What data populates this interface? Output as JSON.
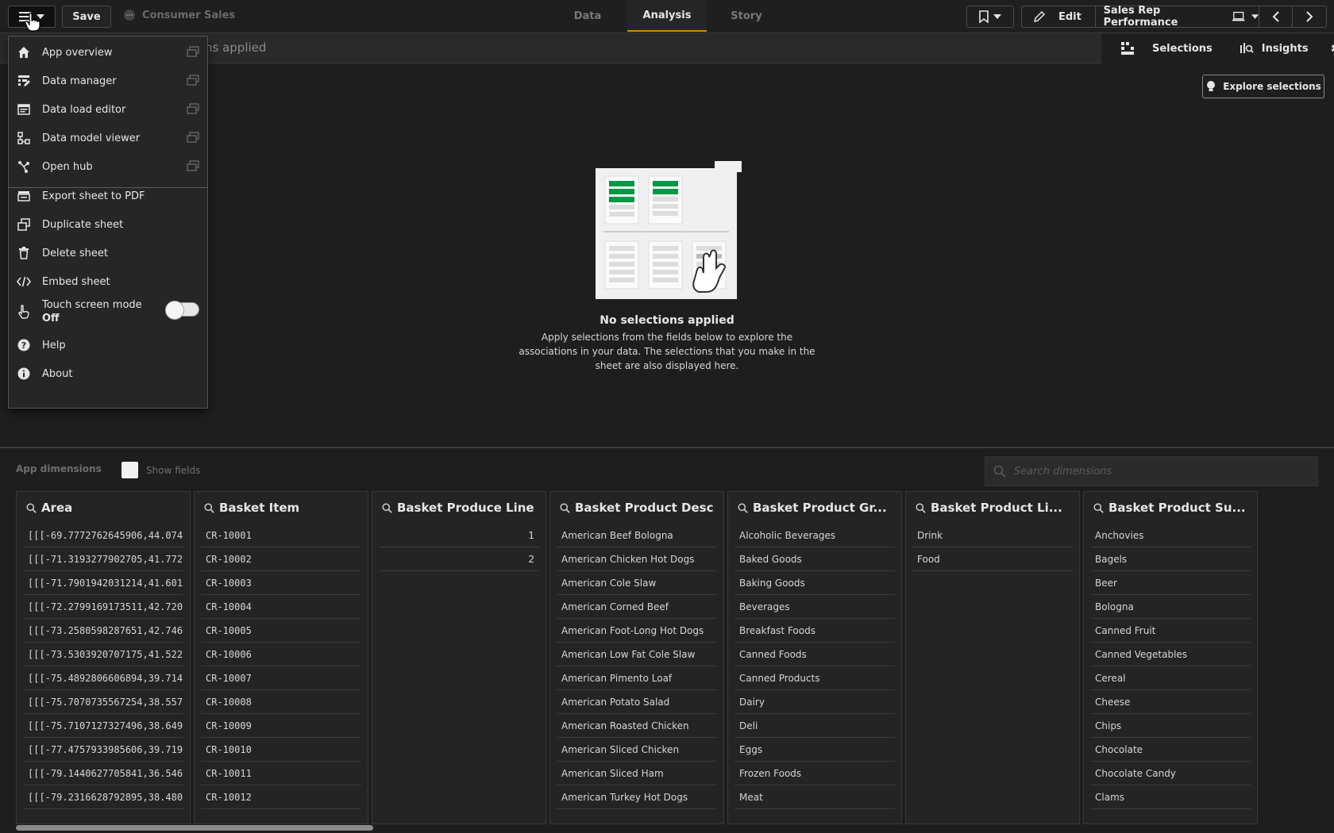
{
  "topbar": {
    "save_label": "Save",
    "app_name": "Consumer Sales",
    "tabs": [
      {
        "label": "Data",
        "active": false
      },
      {
        "label": "Analysis",
        "active": true
      },
      {
        "label": "Story",
        "active": false
      }
    ],
    "edit_label": "Edit",
    "sheet_title": "Sales Rep Performance"
  },
  "subbar": {
    "selections_text": "ns applied",
    "selections_label": "Selections",
    "insights_label": "Insights"
  },
  "main": {
    "explore_label": "Explore selections",
    "empty_title": "No selections applied",
    "empty_desc": "Apply selections from the fields below to explore the associations in your data. The selections that you make in the sheet are also displayed here.",
    "accent_color": "#009845"
  },
  "dims": {
    "label": "App dimensions",
    "show_fields_label": "Show fields",
    "search_placeholder": "Search dimensions"
  },
  "cards": [
    {
      "title": "Area",
      "type": "mono",
      "values": [
        "[[[-69.7772762645906,44.074...",
        "[[[-71.3193277902705,41.772...",
        "[[[-71.7901942031214,41.601...",
        "[[[-72.2799169173511,42.720...",
        "[[[-73.2580598287651,42.746...",
        "[[[-73.5303920707175,41.522...",
        "[[[-75.4892806606894,39.714...",
        "[[[-75.7070735567254,38.557...",
        "[[[-75.7107127327496,38.649...",
        "[[[-77.4757933985606,39.719...",
        "[[[-79.1440627705841,36.546...",
        "[[[-79.2316628792895,38.480..."
      ]
    },
    {
      "title": "Basket Item",
      "type": "mono",
      "values": [
        "CR-10001",
        "CR-10002",
        "CR-10003",
        "CR-10004",
        "CR-10005",
        "CR-10006",
        "CR-10007",
        "CR-10008",
        "CR-10009",
        "CR-10010",
        "CR-10011",
        "CR-10012"
      ]
    },
    {
      "title": "Basket Produce Line",
      "type": "num",
      "values": [
        "1",
        "2"
      ]
    },
    {
      "title": "Basket Product Desc",
      "type": "text",
      "values": [
        "American Beef Bologna",
        "American Chicken Hot Dogs",
        "American Cole Slaw",
        "American Corned Beef",
        "American Foot-Long Hot Dogs",
        "American Low Fat Cole Slaw",
        "American Pimento Loaf",
        "American Potato Salad",
        "American Roasted Chicken",
        "American Sliced Chicken",
        "American Sliced Ham",
        "American Turkey Hot Dogs"
      ]
    },
    {
      "title": "Basket Product Gr...",
      "type": "text",
      "values": [
        "Alcoholic Beverages",
        "Baked Goods",
        "Baking Goods",
        "Beverages",
        "Breakfast Foods",
        "Canned Foods",
        "Canned Products",
        "Dairy",
        "Deli",
        "Eggs",
        "Frozen Foods",
        "Meat"
      ]
    },
    {
      "title": "Basket Product Li...",
      "type": "text",
      "values": [
        "Drink",
        "Food"
      ]
    },
    {
      "title": "Basket Product Su...",
      "type": "text",
      "values": [
        "Anchovies",
        "Bagels",
        "Beer",
        "Bologna",
        "Canned Fruit",
        "Canned Vegetables",
        "Cereal",
        "Cheese",
        "Chips",
        "Chocolate",
        "Chocolate Candy",
        "Clams"
      ]
    }
  ],
  "menu": {
    "items": [
      {
        "label": "App overview",
        "icon": "home-icon",
        "newtab": true
      },
      {
        "label": "Data manager",
        "icon": "data-manager-icon",
        "newtab": true
      },
      {
        "label": "Data load editor",
        "icon": "script-icon",
        "newtab": true
      },
      {
        "label": "Data model viewer",
        "icon": "model-icon",
        "newtab": true
      },
      {
        "label": "Open hub",
        "icon": "hub-icon",
        "newtab": true
      },
      {
        "label": "Export sheet to PDF",
        "icon": "print-icon",
        "newtab": false
      },
      {
        "label": "Duplicate sheet",
        "icon": "duplicate-icon",
        "newtab": false
      },
      {
        "label": "Delete sheet",
        "icon": "trash-icon",
        "newtab": false
      },
      {
        "label": "Embed sheet",
        "icon": "code-icon",
        "newtab": false
      }
    ],
    "touch_label": "Touch screen mode",
    "touch_state": "Off",
    "help_label": "Help",
    "about_label": "About"
  }
}
